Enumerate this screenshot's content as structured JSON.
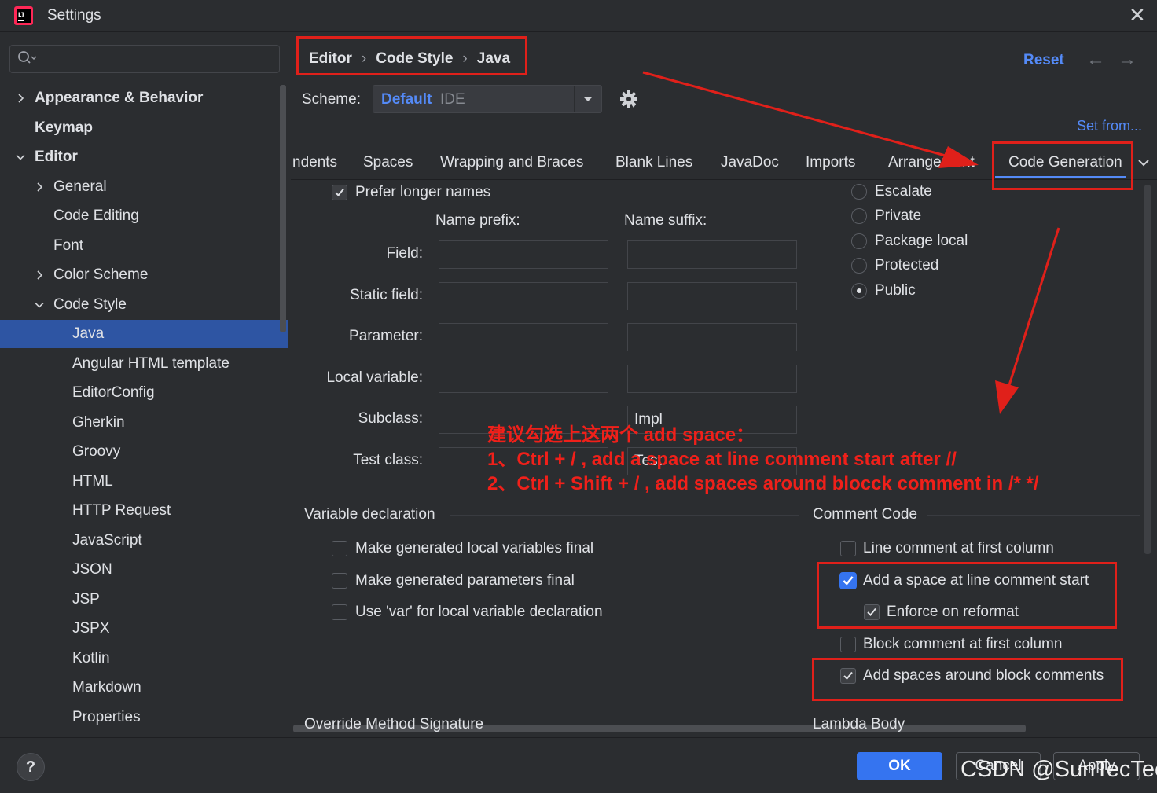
{
  "window": {
    "title": "Settings"
  },
  "sidebar": {
    "items": [
      {
        "label": "Appearance & Behavior"
      },
      {
        "label": "Keymap"
      },
      {
        "label": "Editor"
      },
      {
        "label": "General"
      },
      {
        "label": "Code Editing"
      },
      {
        "label": "Font"
      },
      {
        "label": "Color Scheme"
      },
      {
        "label": "Code Style"
      },
      {
        "label": "Java"
      },
      {
        "label": "Angular HTML template"
      },
      {
        "label": "EditorConfig"
      },
      {
        "label": "Gherkin"
      },
      {
        "label": "Groovy"
      },
      {
        "label": "HTML"
      },
      {
        "label": "HTTP Request"
      },
      {
        "label": "JavaScript"
      },
      {
        "label": "JSON"
      },
      {
        "label": "JSP"
      },
      {
        "label": "JSPX"
      },
      {
        "label": "Kotlin"
      },
      {
        "label": "Markdown"
      },
      {
        "label": "Properties"
      }
    ]
  },
  "breadcrumb": {
    "items": [
      "Editor",
      "Code Style",
      "Java"
    ]
  },
  "header": {
    "reset_label": "Reset"
  },
  "scheme": {
    "label": "Scheme:",
    "name": "Default",
    "type": "IDE",
    "set_from": "Set from..."
  },
  "tabs": [
    {
      "label": "ndents"
    },
    {
      "label": "Spaces"
    },
    {
      "label": "Wrapping and Braces"
    },
    {
      "label": "Blank Lines"
    },
    {
      "label": "JavaDoc"
    },
    {
      "label": "Imports"
    },
    {
      "label": "Arrangement"
    },
    {
      "label": "Code Generation"
    }
  ],
  "naming": {
    "prefer_longer": "Prefer longer names",
    "prefix_header": "Name prefix:",
    "suffix_header": "Name suffix:",
    "rows": [
      {
        "label": "Field:",
        "prefix": "",
        "suffix": ""
      },
      {
        "label": "Static field:",
        "prefix": "",
        "suffix": ""
      },
      {
        "label": "Parameter:",
        "prefix": "",
        "suffix": ""
      },
      {
        "label": "Local variable:",
        "prefix": "",
        "suffix": ""
      },
      {
        "label": "Subclass:",
        "prefix": "",
        "suffix": "Impl"
      },
      {
        "label": "Test class:",
        "prefix": "",
        "suffix": "Test"
      }
    ]
  },
  "visibility": {
    "options": [
      "Escalate",
      "Private",
      "Package local",
      "Protected",
      "Public"
    ],
    "selected": "Public"
  },
  "variable_declaration": {
    "title": "Variable declaration",
    "options": [
      {
        "label": "Make generated local variables final",
        "checked": false
      },
      {
        "label": "Make generated parameters final",
        "checked": false
      },
      {
        "label": "Use 'var' for local variable declaration",
        "checked": false
      }
    ]
  },
  "comment_code": {
    "title": "Comment Code",
    "options": [
      {
        "label": "Line comment at first column",
        "checked": false
      },
      {
        "label": "Add a space at line comment start",
        "checked": true
      },
      {
        "label": "Enforce on reformat",
        "checked": true
      },
      {
        "label": "Block comment at first column",
        "checked": false
      },
      {
        "label": "Add spaces around block comments",
        "checked": true
      }
    ]
  },
  "sections": {
    "override": "Override Method Signature",
    "lambda": "Lambda Body"
  },
  "annotation": {
    "line1": "建议勾选上这两个 add space：",
    "line2": "1、Ctrl + / , add a space at line comment start after //",
    "line3": "2、Ctrl + Shift + / , add spaces around blocck comment in /*  */",
    "color": "#e0201a"
  },
  "footer": {
    "help": "?",
    "ok": "OK",
    "cancel": "Cancel",
    "apply": "Apply"
  },
  "watermark": "CSDN @SunTecTec",
  "colors": {
    "accent": "#548af7",
    "selection": "#2e55a3",
    "primary_button": "#3574f0",
    "background": "#2b2d30"
  }
}
